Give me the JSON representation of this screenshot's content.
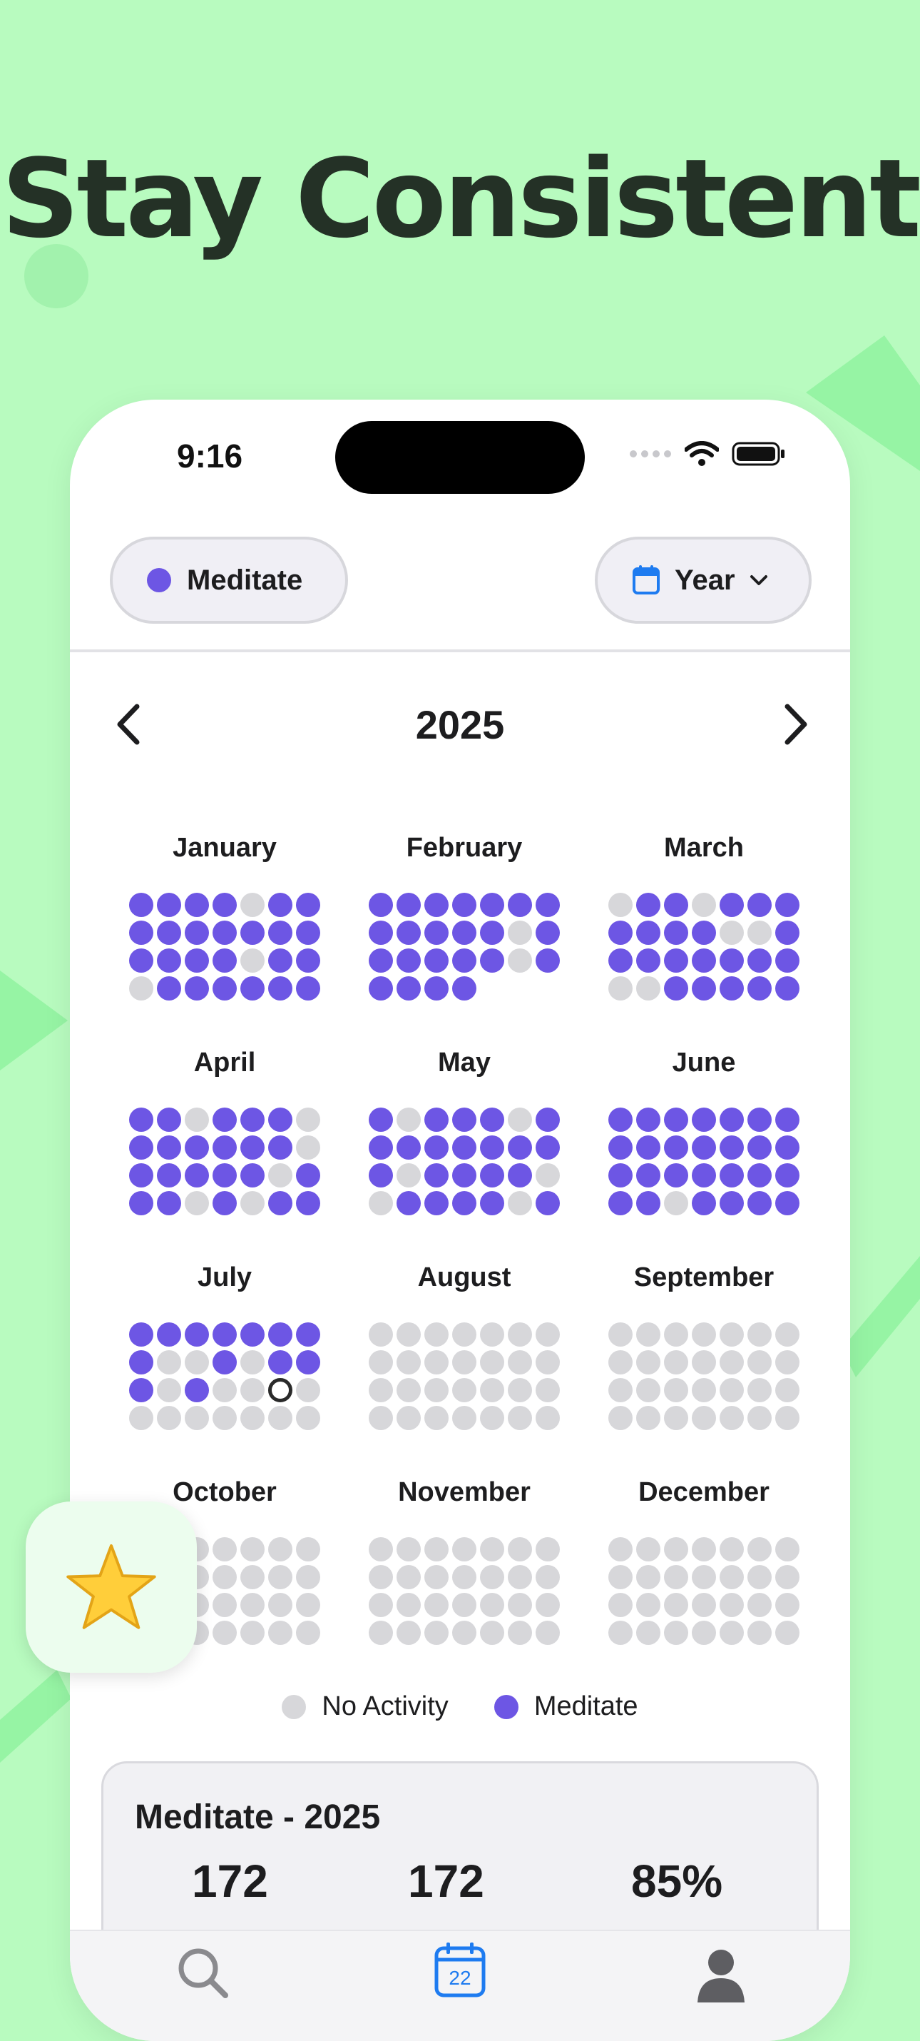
{
  "headline": "Stay Consistent",
  "status_bar": {
    "time": "9:16"
  },
  "filters": {
    "habit_label": "Meditate",
    "range_label": "Year"
  },
  "calendar": {
    "year": "2025",
    "months": [
      {
        "name": "January",
        "days": "1111011111111111110110111111"
      },
      {
        "name": "February",
        "days": "1111111111110111111011111"
      },
      {
        "name": "March",
        "days": "0110111111100111111110011111"
      },
      {
        "name": "April",
        "days": "1101110111111011111011101011"
      },
      {
        "name": "May",
        "days": "1011101111111110111100111101"
      },
      {
        "name": "June",
        "days": "1111111111111111111111101111"
      },
      {
        "name": "July",
        "days": "1111111100101110100000000000"
      },
      {
        "name": "August",
        "days": "0000000000000000000000000000"
      },
      {
        "name": "September",
        "days": "0000000000000000000000000000"
      },
      {
        "name": "October",
        "days": "0000000000000000000000000000"
      },
      {
        "name": "November",
        "days": "0000000000000000000000000000"
      },
      {
        "name": "December",
        "days": "0000000000000000000000000000"
      }
    ],
    "today": {
      "month_index": 6,
      "day_index": 19
    }
  },
  "legend": [
    {
      "label": "No Activity",
      "color": "#d7d7da"
    },
    {
      "label": "Meditate",
      "color": "#6d56e4"
    }
  ],
  "stats": {
    "title": "Meditate - 2025",
    "values": [
      "172",
      "172",
      "85%"
    ]
  },
  "tabbar": {
    "calendar_day": "22"
  },
  "colors": {
    "accent": "#6d56e4",
    "background": "#b8fbbf",
    "blue": "#1e7bf0"
  }
}
